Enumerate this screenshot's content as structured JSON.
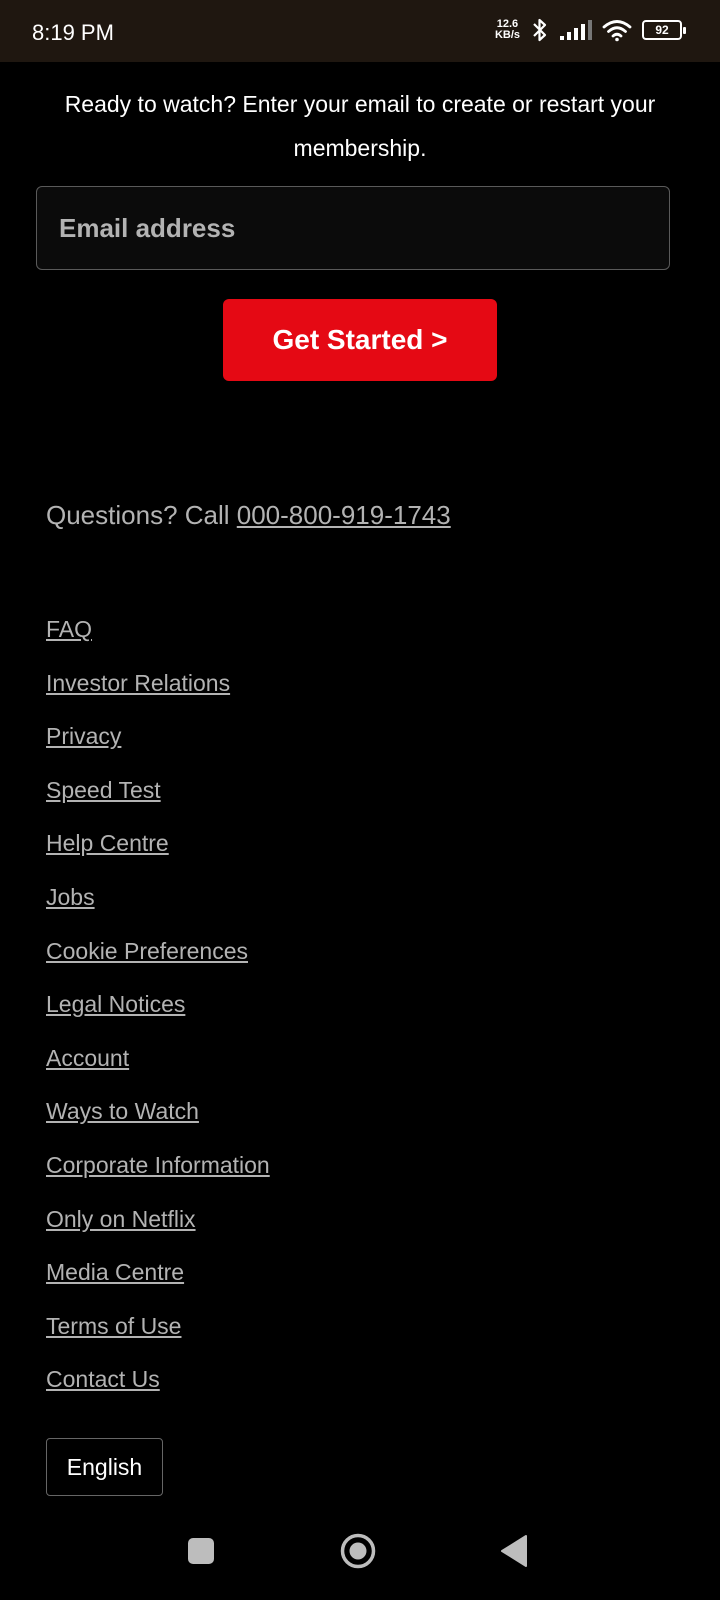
{
  "status_bar": {
    "time": "8:19 PM",
    "net_speed_value": "12.6",
    "net_speed_unit": "KB/s",
    "battery": "92",
    "icons": [
      "bluetooth-icon",
      "signal-icon",
      "wifi-icon",
      "battery-icon"
    ]
  },
  "intro": {
    "text": "Ready to watch? Enter your email to create or restart your membership."
  },
  "email": {
    "placeholder": "Email address",
    "value": ""
  },
  "cta": {
    "label": "Get Started >"
  },
  "questions": {
    "prefix": "Questions? Call ",
    "phone": "000-800-919-1743"
  },
  "footer_links": [
    "FAQ",
    "Investor Relations",
    "Privacy",
    "Speed Test",
    "Help Centre",
    "Jobs",
    "Cookie Preferences",
    "Legal Notices",
    "Account",
    "Ways to Watch",
    "Corporate Information",
    "Only on Netflix",
    "Media Centre",
    "Terms of Use",
    "Contact Us"
  ],
  "language": {
    "selected": "English"
  },
  "colors": {
    "accent": "#e50914",
    "background": "#000000",
    "status_bar": "#1f1710",
    "muted_text": "#b3b3b3"
  },
  "nav_bar": {
    "icons": [
      "recent-apps-icon",
      "home-icon",
      "back-icon"
    ]
  }
}
